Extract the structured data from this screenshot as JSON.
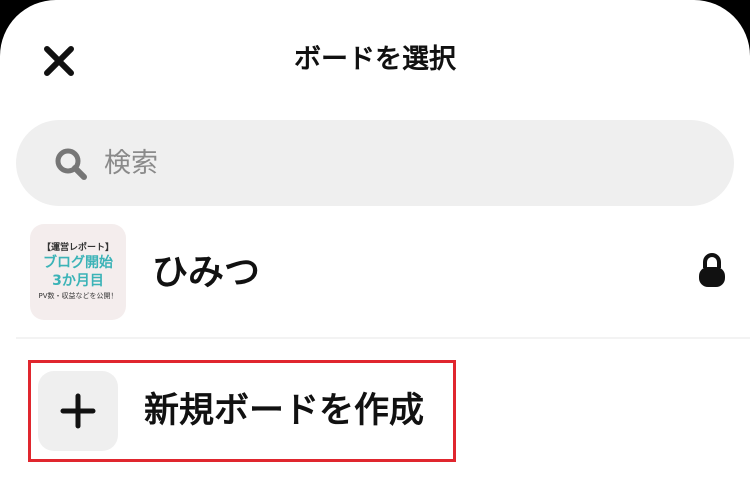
{
  "header": {
    "title": "ボードを選択",
    "close_icon": "close-icon"
  },
  "search": {
    "placeholder": "検索",
    "value": "",
    "icon": "search-icon"
  },
  "boards": [
    {
      "name": "ひみつ",
      "private": true,
      "lock_icon": "lock-icon",
      "thumbnail": {
        "line1": "【運営レポート】",
        "line2": "ブログ開始",
        "line3": "3か月目",
        "line4": "PV数・収益などを公開！"
      }
    }
  ],
  "create": {
    "label": "新規ボードを作成",
    "icon": "plus-icon"
  },
  "colors": {
    "highlight": "#e0262e",
    "thumb_accent": "#3bb3b7",
    "search_bg": "#efefef"
  }
}
